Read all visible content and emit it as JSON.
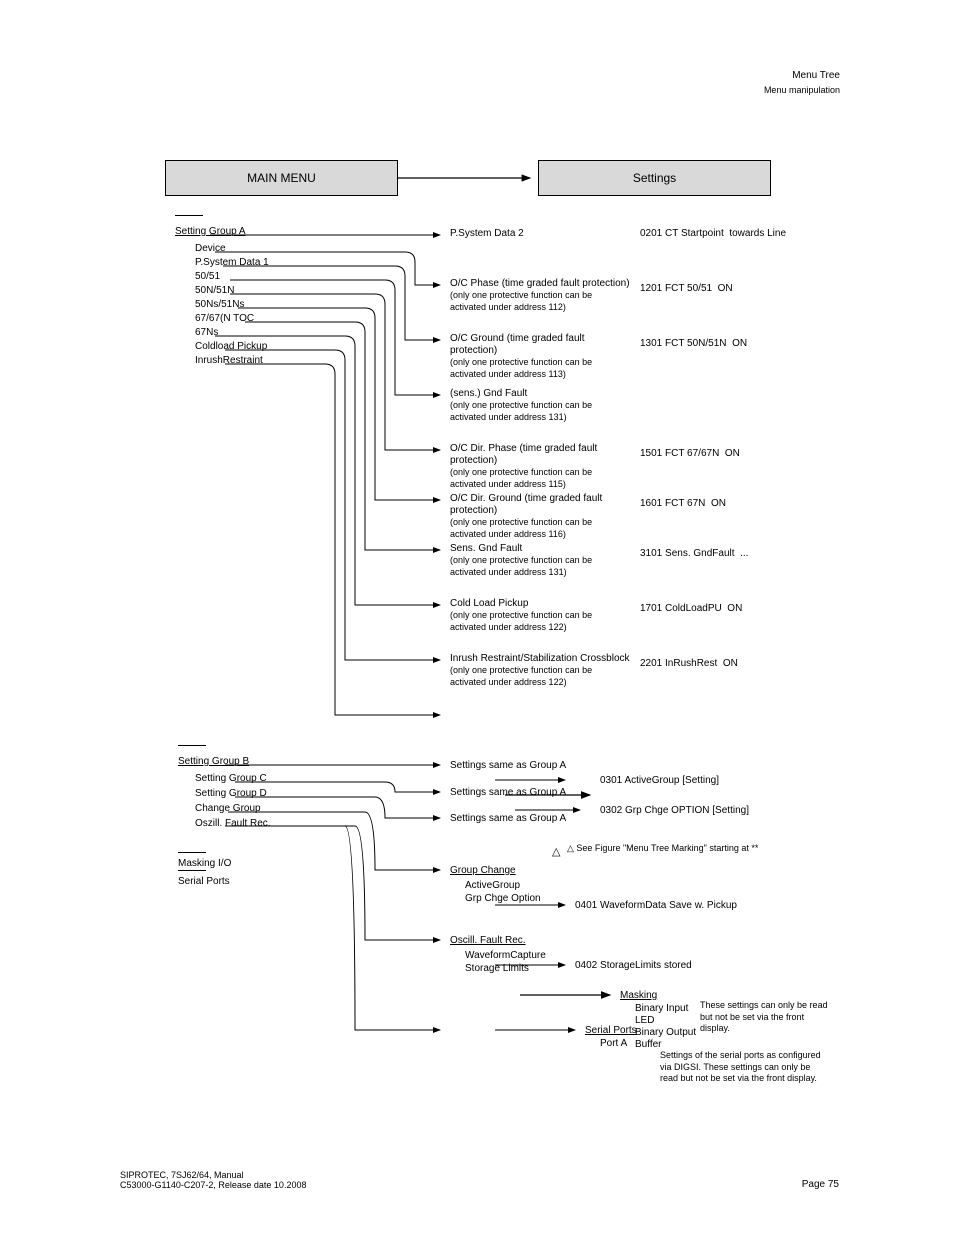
{
  "header": {
    "title": "Menu Tree",
    "subtitle": "Menu manipulation",
    "pageLabel": "Page 75",
    "doc": "SIPROTEC, 7SJ62/64, Manual",
    "docCode": "C53000-G1140-C207-2, Release date 10.2008"
  },
  "boxes": {
    "left": "MAIN MENU",
    "right": "Settings"
  },
  "col1": {
    "groupA": {
      "header": "Setting Group A",
      "items": [
        "Device",
        "P.System Data 1",
        "50/51",
        "50N/51N",
        "50Ns/51Ns",
        "67/67(N TOC",
        "67Ns",
        "Coldload Pickup",
        "InrushRestraint"
      ]
    },
    "groupB": {
      "header": "Setting Group B",
      "items": [
        "Setting Group C",
        "Setting Group D",
        "Change Group",
        "Oszill. Fault Rec."
      ]
    },
    "otherA": "Masking I/O",
    "otherB": "Serial Ports"
  },
  "col2": {
    "items": [
      {
        "text": "P.System Data 2",
        "note": ""
      },
      {
        "text": "O/C Phase (time graded fault protection)",
        "note": "(only one protective function can be activated under address 112)"
      },
      {
        "text": "O/C Ground (time graded fault protection)",
        "note": "(only one protective function can be activated under address 113)"
      },
      {
        "text": "(sens.) Gnd Fault",
        "note": "(only one protective function can be activated under address 131)"
      },
      {
        "text": "O/C Dir. Phase (time graded fault protection)",
        "note": "(only one protective function can be activated under address 115)"
      },
      {
        "text": "O/C Dir. Ground (time graded fault protection)",
        "note": "(only one protective function can be activated under address 116)"
      },
      {
        "text": "Sens. Gnd Fault",
        "note": "(only one protective function can be activated under address 131)"
      },
      {
        "text": "Cold Load Pickup",
        "note": "(only one protective function can be activated under address 122)"
      },
      {
        "text": "Inrush Restraint/Stabilization Crossblock",
        "note": "(only one protective function can be activated under address 122)"
      }
    ],
    "s1": "Settings same as Group A",
    "s2": "Settings same as Group A",
    "s3": "Settings same as Group A",
    "gc_header": "Group Change",
    "gc_items": [
      "ActiveGroup",
      "Grp Chge Option"
    ],
    "os_header": "Oscill. Fault Rec.",
    "os_items": [
      "WaveformCapture",
      "Storage Limits"
    ],
    "delta": "△ See Figure \"Menu Tree Marking\" starting at **"
  },
  "col3": {
    "items": [
      {
        "label": "0201 CT Startpoint",
        "val": "towards Line"
      },
      {
        "label": "1201 FCT 50/51",
        "val": "ON"
      },
      {
        "label": "1301 FCT 50N/51N",
        "val": "ON"
      },
      {
        "label": "",
        "val": ""
      },
      {
        "label": "1501 FCT 67/67N",
        "val": "ON"
      },
      {
        "label": "1601 FCT 67N",
        "val": "ON"
      },
      {
        "label": "3101 Sens. GndFault",
        "val": "..."
      },
      {
        "label": "1701 ColdLoadPU",
        "val": "ON"
      },
      {
        "label": "2201 InRushRest",
        "val": "ON"
      }
    ],
    "gc": [
      {
        "label": "0301 ActiveGroup",
        "val": "[Setting]"
      },
      {
        "label": "0302 Grp Chge OPTION",
        "val": "[Setting]"
      }
    ],
    "os": [
      {
        "label": "0401 WaveformData",
        "val": "Save w. Pickup"
      },
      {
        "label": "0402 StorageLimits",
        "val": "stored"
      }
    ],
    "masking_header": "Masking",
    "masking_items": [
      "Binary Input",
      "LED",
      "Binary Output",
      "Buffer"
    ],
    "masking_note": "These settings can only be read but not be set via the front display.",
    "ports_header": "Serial Ports",
    "ports_items": [
      "Port A"
    ],
    "ports_note": "Settings of the serial ports as configured via DIGSI. These settings can only be read but not be set via the front display."
  }
}
